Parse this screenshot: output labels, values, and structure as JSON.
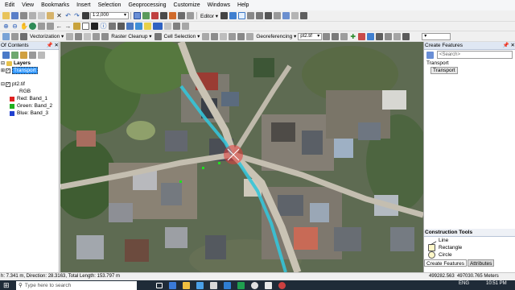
{
  "menu": [
    "Edit",
    "View",
    "Bookmarks",
    "Insert",
    "Selection",
    "Geoprocessing",
    "Customize",
    "Windows",
    "Help"
  ],
  "toolbar1": {
    "scale": "1:2,000",
    "editor_label": "Editor"
  },
  "toolbar2": {
    "vectorization": "Vectorization",
    "raster_cleanup": "Raster Cleanup",
    "cell_selection": "Cell Selection",
    "georeferencing": "Georeferencing",
    "raster_layer": "pt2.tif"
  },
  "toc": {
    "title": "Of Contents",
    "layers_label": "Layers",
    "transport_layer": "Transport",
    "raster_layer": "pt2.tif",
    "rgb_label": "RGB",
    "bands": [
      {
        "label": "Red:   Band_1",
        "color": "#e02020"
      },
      {
        "label": "Green: Band_2",
        "color": "#20b020"
      },
      {
        "label": "Blue:  Band_3",
        "color": "#2040d0"
      }
    ]
  },
  "create_features": {
    "title": "Create Features",
    "search_placeholder": "<Search>",
    "group_label": "Transport",
    "template_item": "Transport"
  },
  "construction_tools": {
    "title": "Construction Tools",
    "items": [
      "Line",
      "Rectangle",
      "Circle"
    ],
    "tab_create": "Create Features",
    "tab_attributes": "Attributes"
  },
  "status": {
    "segment_info": "h: 7.341 m, Direction: 28.3163, Total Length: 153.797 m",
    "coordinates": "499282.563  497030.765 Meters"
  },
  "taskbar": {
    "search_placeholder": "Type here to search",
    "language": "ENG",
    "time": "10:51 PM"
  },
  "colors": {
    "selection_highlight": "#3399ff",
    "road_digitized": "#35c4d8",
    "snap_marker": "#e43b3b",
    "panel_header": "#dfe7f3"
  }
}
